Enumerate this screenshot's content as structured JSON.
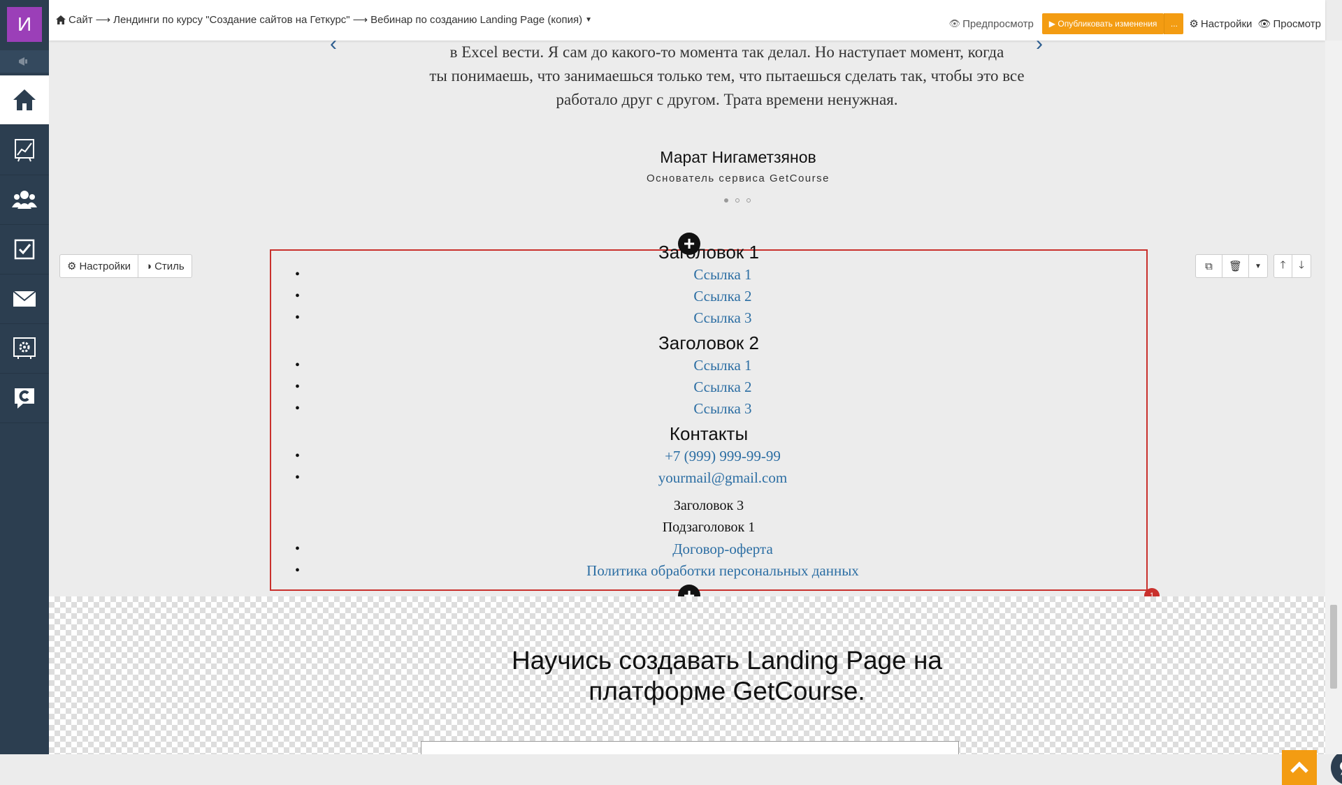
{
  "sidebar": {
    "logo_letter": "И",
    "items": [
      "home-icon",
      "chart-icon",
      "users-icon",
      "tasks-icon",
      "mail-icon",
      "settings-box-icon",
      "getcourse-icon"
    ]
  },
  "topbar": {
    "breadcrumb": {
      "site": "Сайт",
      "section": "Лендинги по курсу \"Создание сайтов на Геткурс\"",
      "page": "Вебинар по созданию Landing Page (копия)"
    },
    "preview": "Предпросмотр",
    "publish": "▶ Опубликовать изменения",
    "publish_more": "...",
    "settings": "Настройки",
    "view": "Просмотр"
  },
  "testimonial": {
    "quote_lines": [
      "в Excel вести. Я сам до какого-то момента так делал. Но наступает момент, когда",
      "ты понимаешь, что занимаешься только тем, что пытаешься сделать так, чтобы это все",
      "работало друг с другом. Трата времени ненужная."
    ],
    "author": "Марат Нигаметзянов",
    "role": "Основатель сервиса GetCourse"
  },
  "block_toolbar": {
    "settings": "Настройки",
    "style": "Стиль"
  },
  "footer_menu": {
    "heading1": "Заголовок 1",
    "links1": [
      "Ссылка 1",
      "Ссылка 2",
      "Ссылка 3"
    ],
    "heading2": "Заголовок 2",
    "links2": [
      "Ссылка 1",
      "Ссылка 2",
      "Ссылка 3"
    ],
    "heading3": "Контакты",
    "contacts": [
      "+7 (999) 999-99-99",
      "yourmail@gmail.com"
    ],
    "heading4": "Заголовок 3",
    "subheading": "Подзаголовок 1",
    "legal": [
      "Договор-оферта",
      "Политика обработки персональных данных"
    ]
  },
  "badge_count": "1",
  "cta": {
    "line1": "Научись создавать Landing Page на",
    "line2": "платформе GetCourse."
  },
  "colors": {
    "brand_purple": "#9b3fb8",
    "sidebar": "#2c3e50",
    "publish_orange": "#f39c12",
    "selection_red": "#c9302c",
    "link_blue": "#2c6ea3"
  }
}
